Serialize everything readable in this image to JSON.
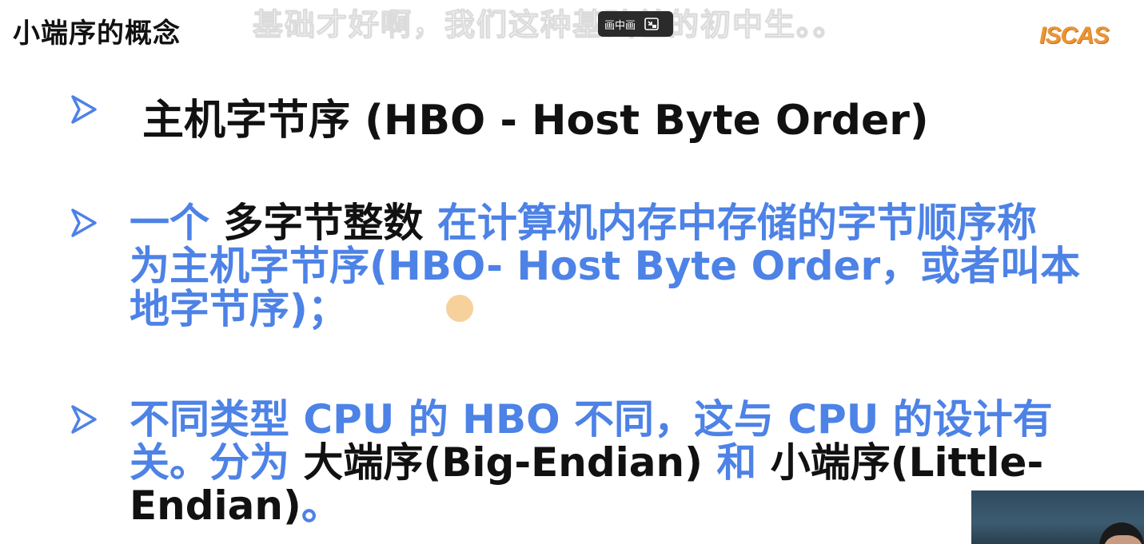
{
  "slide": {
    "title": "小端序的概念",
    "subtitle_overlay": "基础才好啊，我们这种基础差的初中生。。",
    "logo_text": "ISCAS",
    "heading": "主机字节序 (HBO - Host Byte Order)",
    "paragraph1": {
      "line1_dark": "一个 多字节整数",
      "line1_blue_lead": "一个 ",
      "line1_dark_mid": "多字节整数",
      "line1_blue_tail": " 在计算机内存中存储的字节顺序称",
      "line2": "为主机字节序(HBO- Host Byte Order，或者叫本",
      "line3": "地字节序)；"
    },
    "paragraph2": {
      "line1": "不同类型 CPU 的 HBO 不同，这与 CPU 的设计有",
      "line2_blue_a": "关。分为 ",
      "line2_dark_a": "大端序(Big-Endian)",
      "line2_blue_b": " 和 ",
      "line2_dark_b": "小端序(Little-",
      "line3_dark": "Endian)",
      "line3_blue": "。"
    }
  },
  "player": {
    "pip_label": "画中画",
    "pip_icon": "exit-fullscreen-icon"
  },
  "colors": {
    "accent_blue": "#4d82e6",
    "text_dark": "#111111",
    "logo_orange": "#e88a1e",
    "pointer": "#f6c98a"
  }
}
